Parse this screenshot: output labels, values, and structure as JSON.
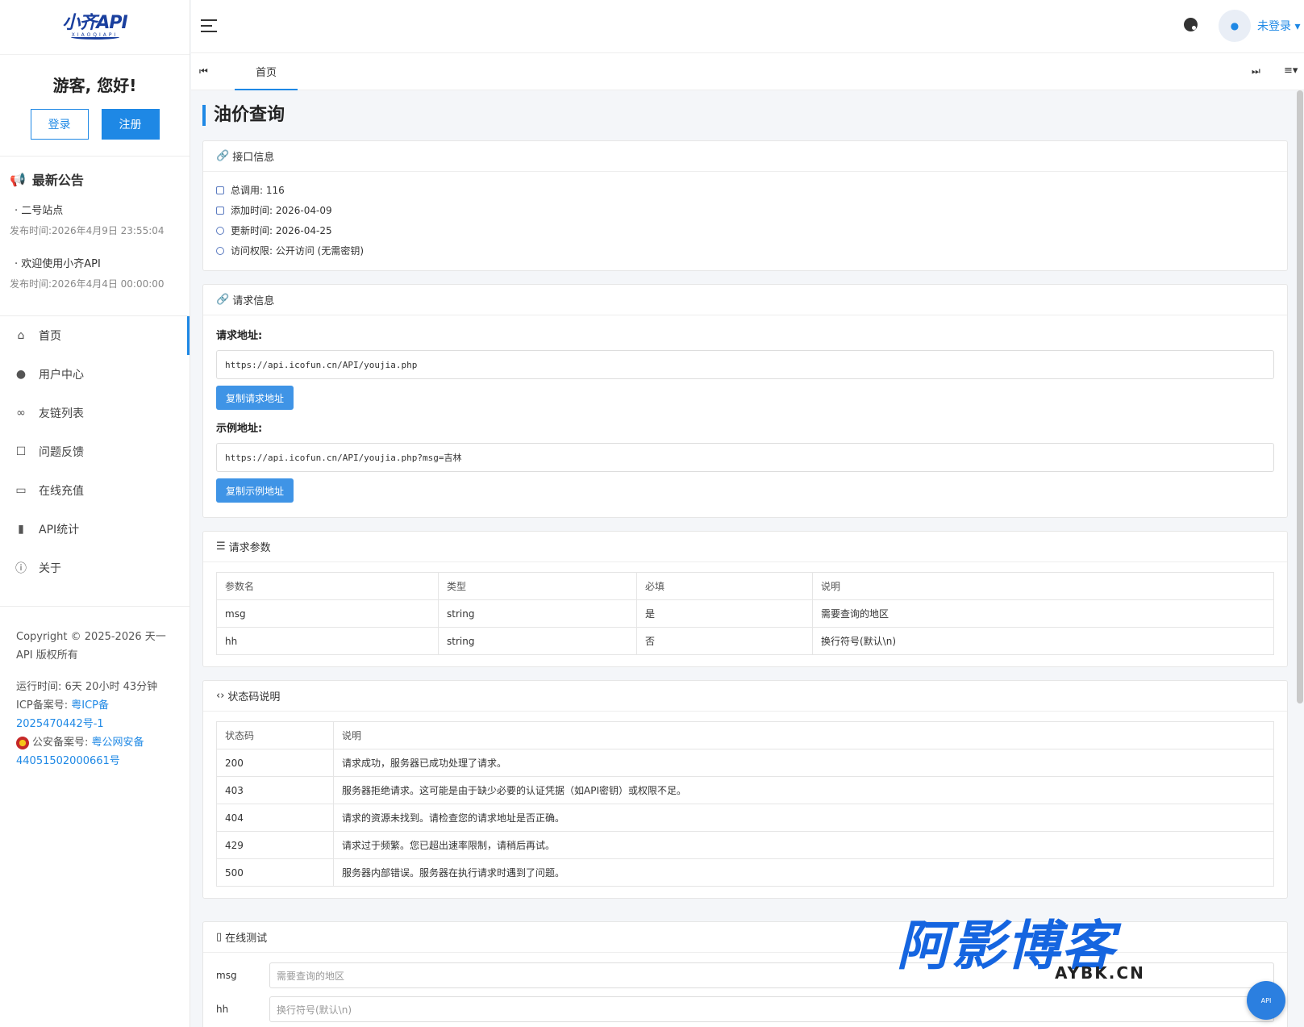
{
  "brand": {
    "logo_main": "小齐API",
    "logo_sub": "XIAOQIAPI",
    "color": "#1e88e5"
  },
  "user": {
    "greeting": "游客, 您好!",
    "login": "登录",
    "register": "注册",
    "status": "未登录"
  },
  "notice": {
    "title": "最新公告",
    "items": [
      {
        "title": "二号站点",
        "date": "发布时间:2026年4月9日 23:55:04"
      },
      {
        "title": "欢迎使用小齐API",
        "date": "发布时间:2026年4月4日 00:00:00"
      }
    ]
  },
  "nav": [
    {
      "label": "首页",
      "icon": "home-icon"
    },
    {
      "label": "用户中心",
      "icon": "user-icon"
    },
    {
      "label": "友链列表",
      "icon": "link-icon"
    },
    {
      "label": "问题反馈",
      "icon": "feedback-icon"
    },
    {
      "label": "在线充值",
      "icon": "card-icon"
    },
    {
      "label": "API统计",
      "icon": "chart-icon"
    },
    {
      "label": "关于",
      "icon": "info-icon"
    }
  ],
  "footer": {
    "copyright": "Copyright © 2025-2026 天一API 版权所有",
    "uptime": "运行时间: 6天 20小时 43分钟",
    "icp_label": "ICP备案号: ",
    "icp_value": "粤ICP备2025470442号-1",
    "police_label": "公安备案号: ",
    "police_value": "粤公网安备44051502000661号"
  },
  "tabs": {
    "home": "首页"
  },
  "page": {
    "title": "油价查询"
  },
  "api_info": {
    "heading": "接口信息",
    "total_calls": "总调用: 116",
    "added": "添加时间: 2026-04-09",
    "updated": "更新时间: 2026-04-25",
    "access": "访问权限: 公开访问 (无需密钥)"
  },
  "request": {
    "heading": "请求信息",
    "url_label": "请求地址:",
    "url": "https://api.icofun.cn/API/youjia.php",
    "copy_url": "复制请求地址",
    "example_label": "示例地址:",
    "example": "https://api.icofun.cn/API/youjia.php?msg=吉林",
    "copy_example": "复制示例地址"
  },
  "params": {
    "heading": "请求参数",
    "headers": [
      "参数名",
      "类型",
      "必填",
      "说明"
    ],
    "rows": [
      [
        "msg",
        "string",
        "是",
        "需要查询的地区"
      ],
      [
        "hh",
        "string",
        "否",
        "换行符号(默认\\n)"
      ]
    ]
  },
  "status_codes": {
    "heading": "状态码说明",
    "headers": [
      "状态码",
      "说明"
    ],
    "rows": [
      [
        "200",
        "请求成功，服务器已成功处理了请求。"
      ],
      [
        "403",
        "服务器拒绝请求。这可能是由于缺少必要的认证凭据（如API密钥）或权限不足。"
      ],
      [
        "404",
        "请求的资源未找到。请检查您的请求地址是否正确。"
      ],
      [
        "429",
        "请求过于频繁。您已超出速率限制，请稍后再试。"
      ],
      [
        "500",
        "服务器内部错误。服务器在执行请求时遇到了问题。"
      ]
    ]
  },
  "test": {
    "heading": "在线测试",
    "fields": [
      {
        "label": "msg",
        "placeholder": "需要查询的地区"
      },
      {
        "label": "hh",
        "placeholder": "换行符号(默认\\n)"
      }
    ]
  },
  "watermark": {
    "main": "阿影博客",
    "sub": "AYBK.CN"
  },
  "float_button": "API"
}
